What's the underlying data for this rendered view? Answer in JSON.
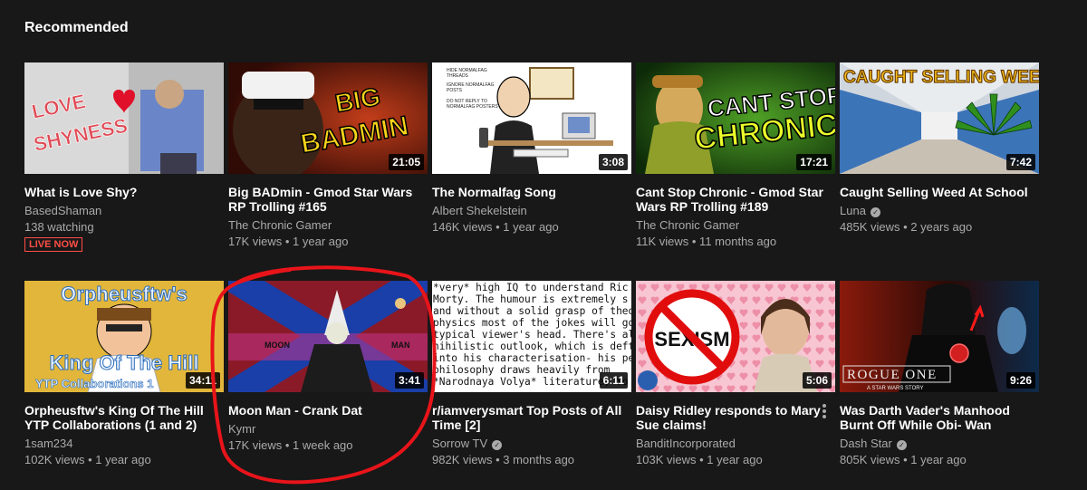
{
  "section": {
    "title": "Recommended"
  },
  "videos": [
    {
      "title": "What is Love Shy?",
      "channel": "BasedShaman",
      "stats": "138 watching",
      "live_label": "LIVE NOW",
      "thumb_text": [
        "LOVE",
        "SHYNESS"
      ]
    },
    {
      "title": "Big BADmin - Gmod Star Wars RP Trolling #165",
      "channel": "The Chronic Gamer",
      "stats": "17K views • 1 year ago",
      "duration": "21:05",
      "thumb_text": [
        "BIG",
        "BADMIN"
      ]
    },
    {
      "title": "The Normalfag Song",
      "channel": "Albert Shekelstein",
      "stats": "146K views • 1 year ago",
      "duration": "3:08",
      "thumb_text": [
        "HIDE NORMALFAG",
        "THREADS",
        "IGNORE NORMALFAG",
        "POSTS",
        "DO NOT REPLY TO",
        "NORMALFAG POSTERS"
      ]
    },
    {
      "title": "Cant Stop Chronic - Gmod Star Wars RP Trolling #189",
      "channel": "The Chronic Gamer",
      "stats": "11K views • 11 months ago",
      "duration": "17:21",
      "thumb_text": [
        "CANT STOP",
        "CHRONIC"
      ]
    },
    {
      "title": "Caught Selling Weed At School",
      "channel": "Luna",
      "stats": "485K views • 2 years ago",
      "duration": "7:42",
      "thumb_text": [
        "CAUGHT SELLING WEED"
      ]
    },
    {
      "title": "Orpheusftw's King Of The Hill YTP Collaborations (1 and 2)",
      "channel": "1sam234",
      "stats": "102K views • 1 year ago",
      "duration": "34:11",
      "thumb_text": [
        "Orpheusftw's",
        "King Of The Hill",
        "YTP Collaborations 1"
      ]
    },
    {
      "title": "Moon Man - Crank Dat",
      "channel": "Kymr",
      "stats": "17K views • 1 week ago",
      "duration": "3:41",
      "thumb_text": [
        "MOON",
        "MAN"
      ]
    },
    {
      "title": "r/iamverysmart Top Posts of All Time [2]",
      "channel": "Sorrow TV",
      "stats": "982K views • 3 months ago",
      "duration": "6:11",
      "thumb_text": [
        "*very* high IQ to understand Ric",
        "Morty. The humour is extremely s",
        "and without a solid grasp of theo",
        "physics  most of the jokes will go",
        "typical viewer's head. There's als",
        "nihilistic outlook, which is deftly",
        "into his characterisation- his per",
        "philosophy draws heavily from",
        "*Narodnaya Volya* literature, fo"
      ]
    },
    {
      "title": "Daisy Ridley responds to Mary Sue claims!",
      "channel": "BanditIncorporated",
      "stats": "103K views • 1 year ago",
      "duration": "5:06",
      "thumb_text": [
        "SEXISM"
      ]
    },
    {
      "title": "Was Darth Vader's Manhood Burnt Off While Obi- Wan",
      "channel": "Dash Star",
      "stats": "805K views • 1 year ago",
      "duration": "9:26",
      "thumb_text": [
        "ROGUE ONE",
        "A STAR WARS STORY"
      ]
    }
  ],
  "verified_channels": [
    "The Normalfag Song"
  ],
  "colors": {
    "background": "#181818",
    "live": "#ff4e45",
    "annotation": "#e8141a"
  }
}
